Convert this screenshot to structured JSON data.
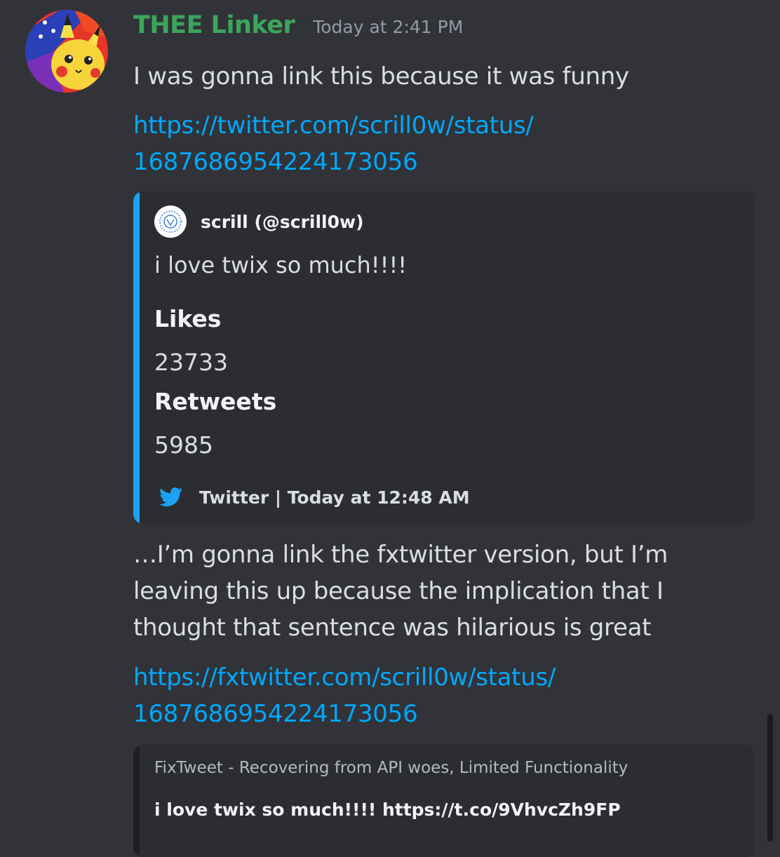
{
  "message": {
    "username": "THEE Linker",
    "timestamp": "Today at 2:41 PM",
    "text1": "I was gonna link this because it was funny",
    "link1": {
      "line1": "https://twitter.com/scrill0w/status/",
      "line2": "1687686954224173056"
    },
    "text2": {
      "line1": "…I’m gonna link the fxtwitter version, but I’m",
      "line2": "leaving this up because the implication that I",
      "line3": "thought that sentence was hilarious is great"
    },
    "link2": {
      "line1": "https://fxtwitter.com/scrill0w/status/",
      "line2": "1687686954224173056"
    }
  },
  "embed1": {
    "author": "scrill (@scrill0w)",
    "description": "i love twix so much!!!!",
    "fields": [
      {
        "name": "Likes",
        "value": "23733"
      },
      {
        "name": "Retweets",
        "value": "5985"
      }
    ],
    "footer": "Twitter | Today at 12:48 AM",
    "bar_color": "#1da1f2"
  },
  "embed2": {
    "provider": "FixTweet - Recovering from API woes, Limited Functionality",
    "description": "i love twix so much!!!! https://t.co/9VhvcZh9FP"
  },
  "icons": {
    "avatar": "pikachu-avatar-icon",
    "author": "scrill-logo-icon",
    "footer": "twitter-bird-icon"
  },
  "colors": {
    "background": "#313338",
    "username": "#3ba55c",
    "link": "#00a8fc",
    "embed_bg": "#2b2d31"
  }
}
